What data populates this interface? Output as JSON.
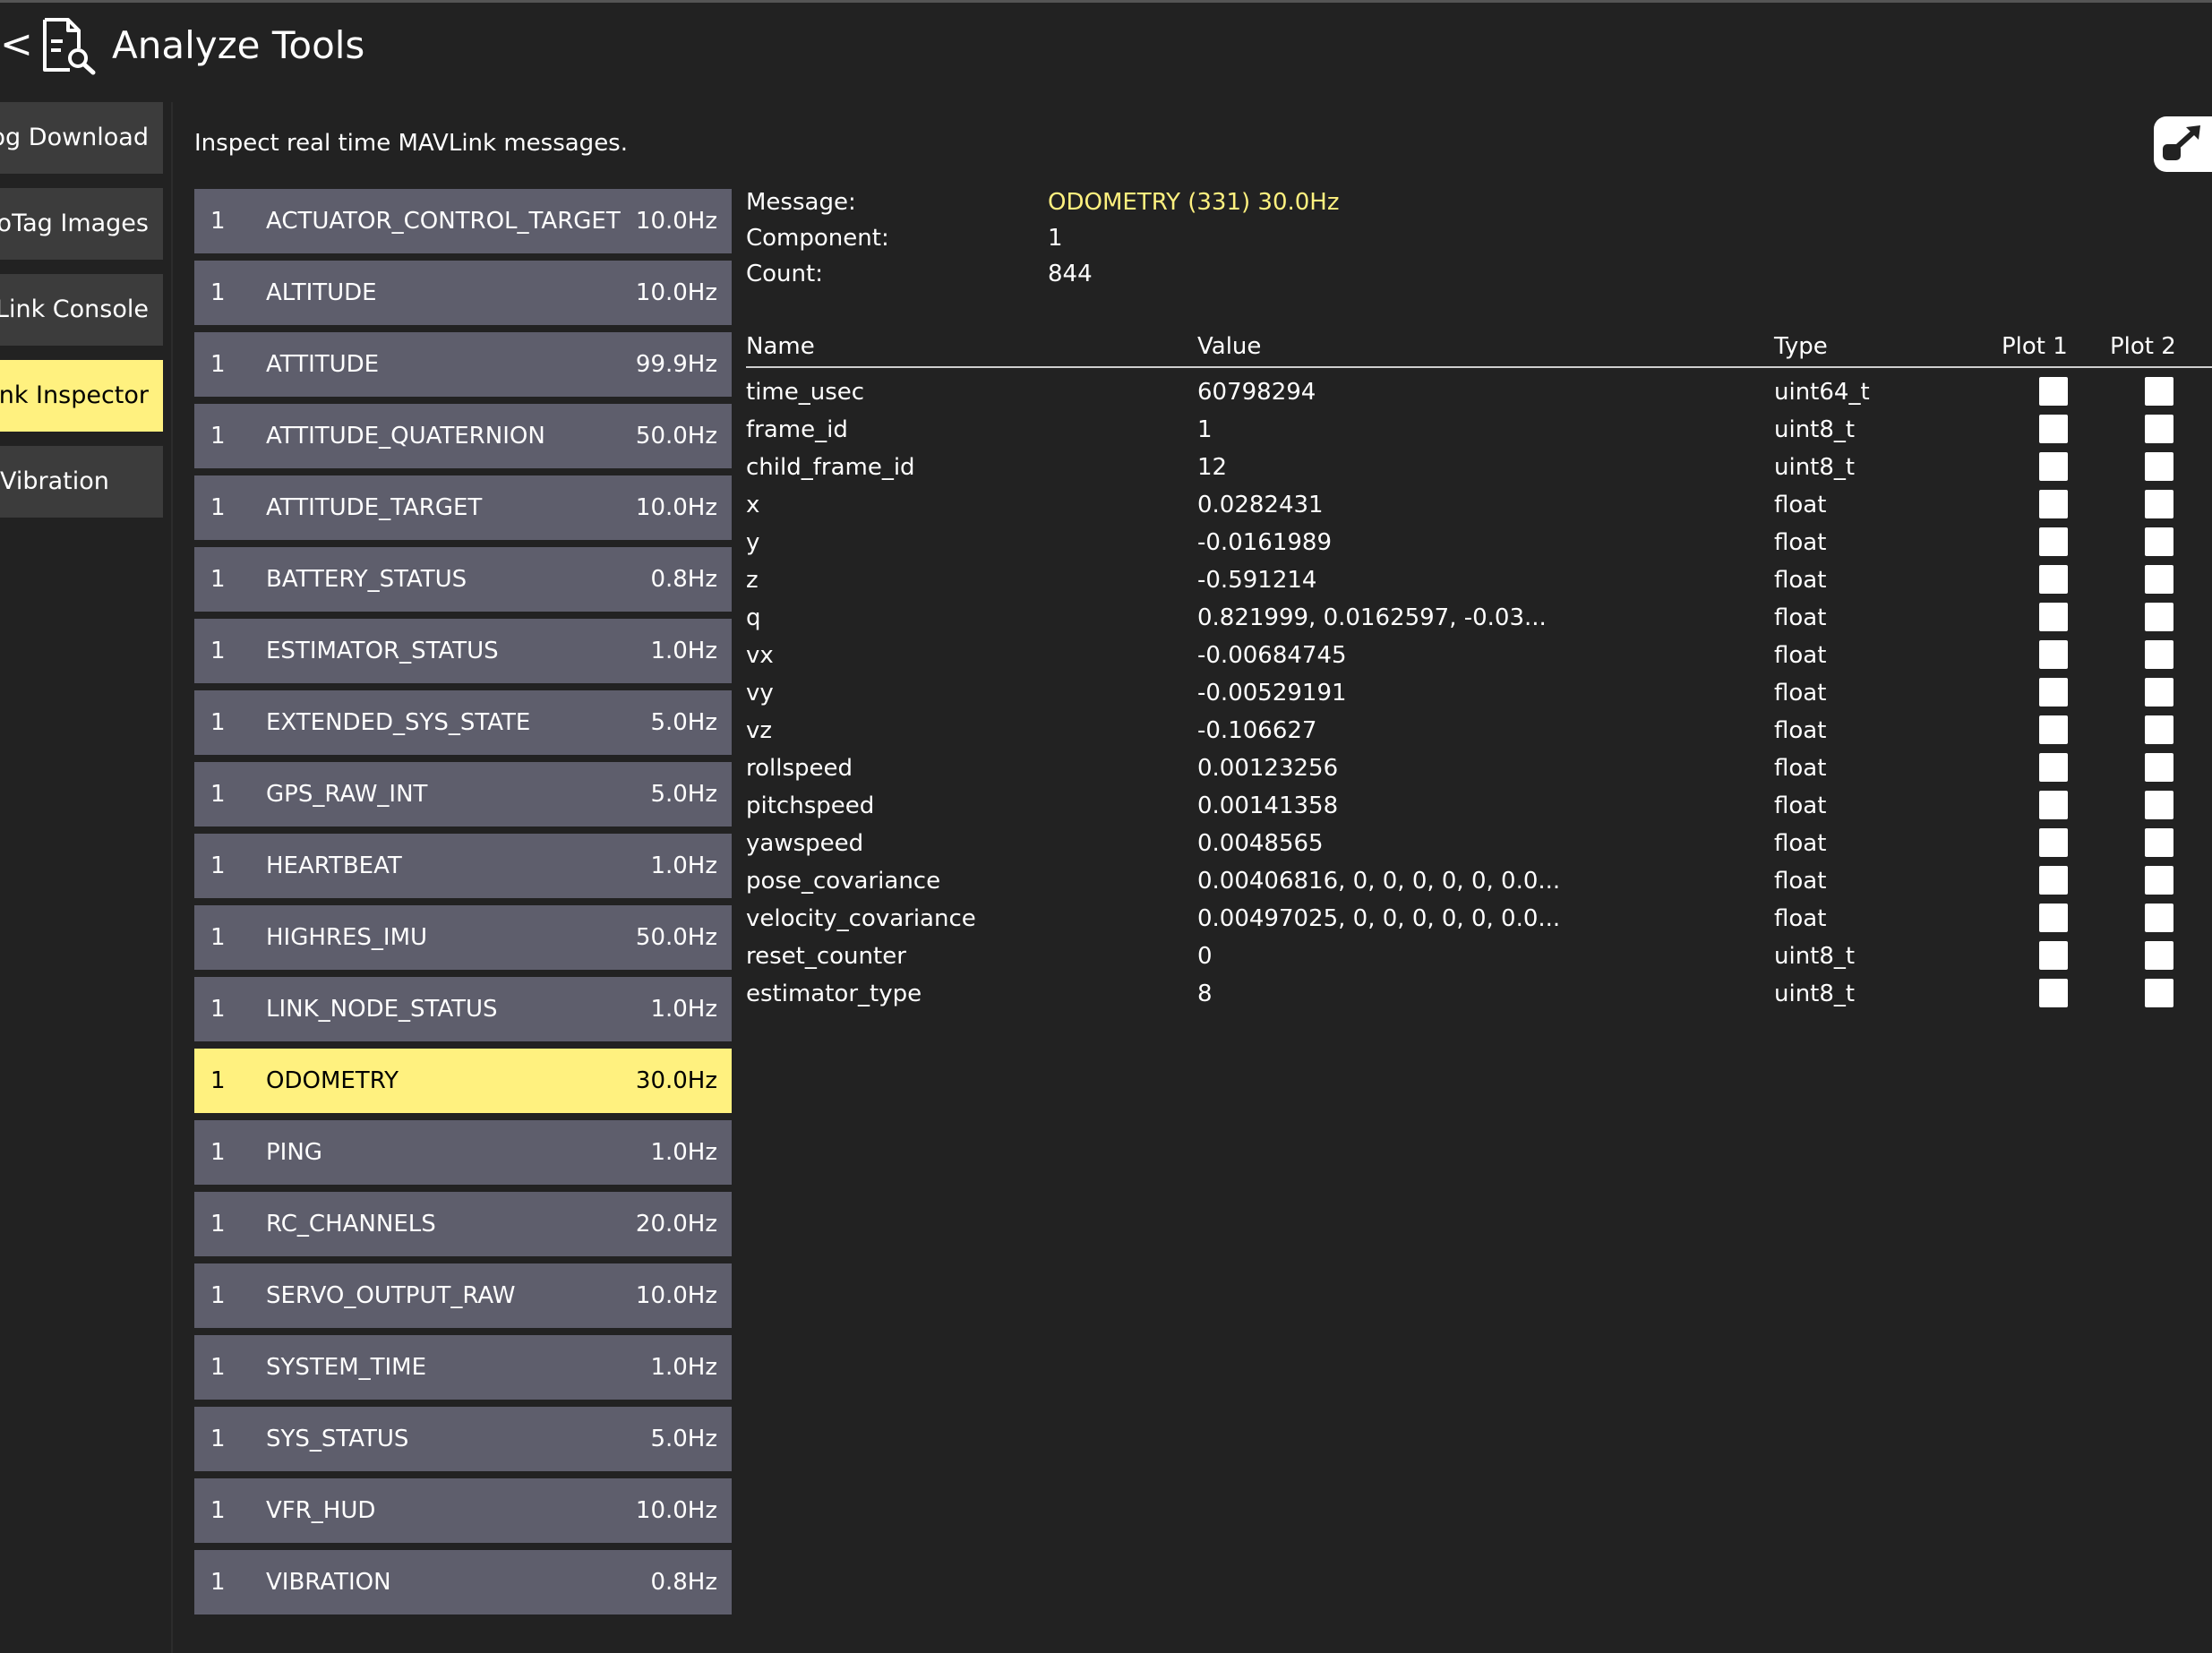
{
  "header": {
    "back_label": "<",
    "title": "Analyze Tools",
    "icon": "document-search-icon"
  },
  "sidebar": {
    "items": [
      {
        "label": "Log Download",
        "active": false
      },
      {
        "label": "GeoTag Images",
        "active": false
      },
      {
        "label": "MAVLink Console",
        "active": false
      },
      {
        "label": "MAVLink Inspector",
        "active": true
      },
      {
        "label": "Vibration",
        "active": false
      }
    ]
  },
  "description": "Inspect real time MAVLink messages.",
  "messages": [
    {
      "comp": "1",
      "name": "ACTUATOR_CONTROL_TARGET",
      "rate": "10.0Hz"
    },
    {
      "comp": "1",
      "name": "ALTITUDE",
      "rate": "10.0Hz"
    },
    {
      "comp": "1",
      "name": "ATTITUDE",
      "rate": "99.9Hz"
    },
    {
      "comp": "1",
      "name": "ATTITUDE_QUATERNION",
      "rate": "50.0Hz"
    },
    {
      "comp": "1",
      "name": "ATTITUDE_TARGET",
      "rate": "10.0Hz"
    },
    {
      "comp": "1",
      "name": "BATTERY_STATUS",
      "rate": "0.8Hz"
    },
    {
      "comp": "1",
      "name": "ESTIMATOR_STATUS",
      "rate": "1.0Hz"
    },
    {
      "comp": "1",
      "name": "EXTENDED_SYS_STATE",
      "rate": "5.0Hz"
    },
    {
      "comp": "1",
      "name": "GPS_RAW_INT",
      "rate": "5.0Hz"
    },
    {
      "comp": "1",
      "name": "HEARTBEAT",
      "rate": "1.0Hz"
    },
    {
      "comp": "1",
      "name": "HIGHRES_IMU",
      "rate": "50.0Hz"
    },
    {
      "comp": "1",
      "name": "LINK_NODE_STATUS",
      "rate": "1.0Hz"
    },
    {
      "comp": "1",
      "name": "ODOMETRY",
      "rate": "30.0Hz",
      "selected": true
    },
    {
      "comp": "1",
      "name": "PING",
      "rate": "1.0Hz"
    },
    {
      "comp": "1",
      "name": "RC_CHANNELS",
      "rate": "20.0Hz"
    },
    {
      "comp": "1",
      "name": "SERVO_OUTPUT_RAW",
      "rate": "10.0Hz"
    },
    {
      "comp": "1",
      "name": "SYSTEM_TIME",
      "rate": "1.0Hz"
    },
    {
      "comp": "1",
      "name": "SYS_STATUS",
      "rate": "5.0Hz"
    },
    {
      "comp": "1",
      "name": "VFR_HUD",
      "rate": "10.0Hz"
    },
    {
      "comp": "1",
      "name": "VIBRATION",
      "rate": "0.8Hz"
    }
  ],
  "detail": {
    "message_label": "Message:",
    "message_value": "ODOMETRY (331) 30.0Hz",
    "component_label": "Component:",
    "component_value": "1",
    "count_label": "Count:",
    "count_value": "844",
    "columns": {
      "name": "Name",
      "value": "Value",
      "type": "Type",
      "plot1": "Plot 1",
      "plot2": "Plot 2"
    },
    "fields": [
      {
        "name": "time_usec",
        "value": "60798294",
        "type": "uint64_t"
      },
      {
        "name": "frame_id",
        "value": "1",
        "type": "uint8_t"
      },
      {
        "name": "child_frame_id",
        "value": "12",
        "type": "uint8_t"
      },
      {
        "name": "x",
        "value": "0.0282431",
        "type": "float"
      },
      {
        "name": "y",
        "value": "-0.0161989",
        "type": "float"
      },
      {
        "name": "z",
        "value": "-0.591214",
        "type": "float"
      },
      {
        "name": "q",
        "value": "0.821999, 0.0162597, -0.03...",
        "type": "float"
      },
      {
        "name": "vx",
        "value": "-0.00684745",
        "type": "float"
      },
      {
        "name": "vy",
        "value": "-0.00529191",
        "type": "float"
      },
      {
        "name": "vz",
        "value": "-0.106627",
        "type": "float"
      },
      {
        "name": "rollspeed",
        "value": "0.00123256",
        "type": "float"
      },
      {
        "name": "pitchspeed",
        "value": "0.00141358",
        "type": "float"
      },
      {
        "name": "yawspeed",
        "value": "0.0048565",
        "type": "float"
      },
      {
        "name": "pose_covariance",
        "value": "0.00406816, 0, 0, 0, 0, 0, 0.0...",
        "type": "float"
      },
      {
        "name": "velocity_covariance",
        "value": "0.00497025, 0, 0, 0, 0, 0, 0.0...",
        "type": "float"
      },
      {
        "name": "reset_counter",
        "value": "0",
        "type": "uint8_t"
      },
      {
        "name": "estimator_type",
        "value": "8",
        "type": "uint8_t"
      }
    ]
  },
  "colors": {
    "background": "#222222",
    "row": "#5e5e6c",
    "selected": "#fff17f",
    "sidebar": "#3c3c3c"
  },
  "popout_icon": "popout-icon"
}
